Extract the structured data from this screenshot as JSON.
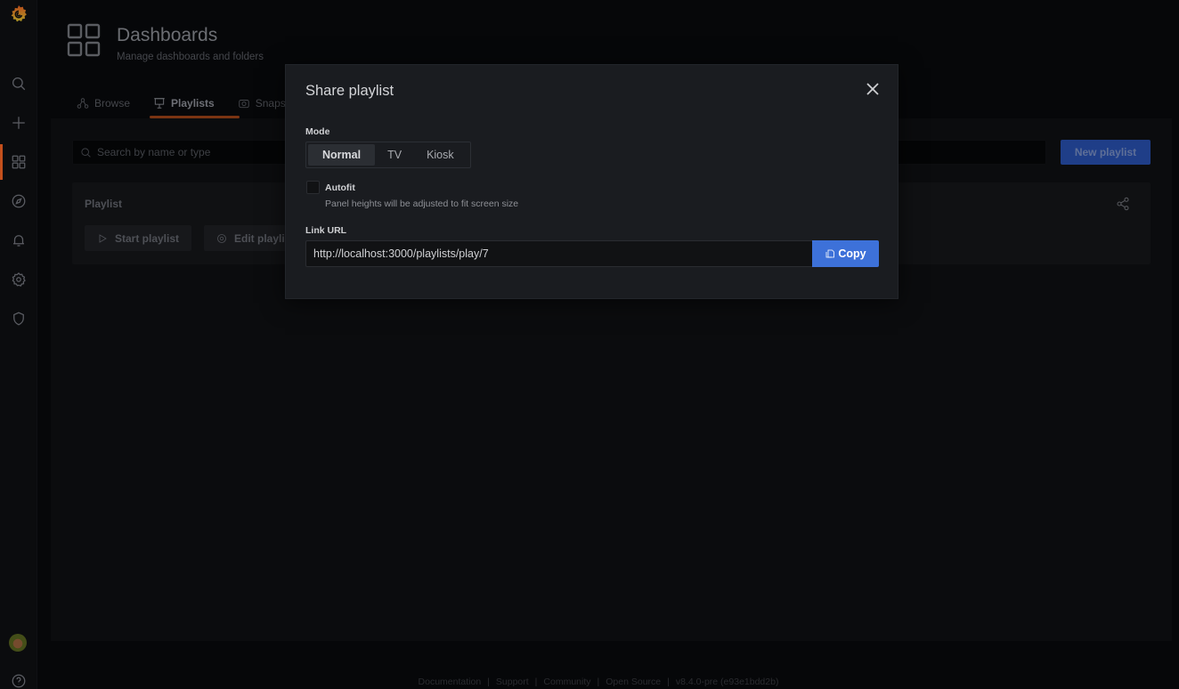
{
  "sidebar": {
    "items": [
      {
        "name": "search",
        "icon": "search-icon"
      },
      {
        "name": "create",
        "icon": "plus-icon"
      },
      {
        "name": "dashboards",
        "icon": "apps-icon",
        "active": true
      },
      {
        "name": "explore",
        "icon": "compass-icon"
      },
      {
        "name": "alerting",
        "icon": "bell-icon"
      },
      {
        "name": "configuration",
        "icon": "cog-icon"
      },
      {
        "name": "server-admin",
        "icon": "shield-icon"
      }
    ],
    "bottom": [
      {
        "name": "profile",
        "icon": "avatar"
      },
      {
        "name": "help",
        "icon": "question-circle-icon"
      }
    ],
    "accent_color": "#c4501c"
  },
  "header": {
    "title": "Dashboards",
    "subtitle": "Manage dashboards and folders"
  },
  "tabs": [
    {
      "label": "Browse",
      "icon": "sitemap-icon",
      "active": false
    },
    {
      "label": "Playlists",
      "icon": "presentation-icon",
      "active": true
    },
    {
      "label": "Snapshots",
      "icon": "camera-icon",
      "active": false
    }
  ],
  "toolbar": {
    "search_placeholder": "Search by name or type",
    "search_value": "",
    "new_playlist_label": "New playlist"
  },
  "playlist_card": {
    "title": "Playlist",
    "start_label": "Start playlist",
    "edit_label": "Edit playlist"
  },
  "modal": {
    "title": "Share playlist",
    "mode_label": "Mode",
    "mode_options": [
      "Normal",
      "TV",
      "Kiosk"
    ],
    "mode_selected": "Normal",
    "autofit_label": "Autofit",
    "autofit_checked": false,
    "autofit_description": "Panel heights will be adjusted to fit screen size",
    "link_label": "Link URL",
    "link_value": "http://localhost:3000/playlists/play/7",
    "copy_label": "Copy",
    "primary_color": "#3d71d9"
  },
  "footer": {
    "items": [
      "Documentation",
      "Support",
      "Community",
      "Open Source",
      "v8.4.0-pre (e93e1bdd2b)"
    ]
  }
}
